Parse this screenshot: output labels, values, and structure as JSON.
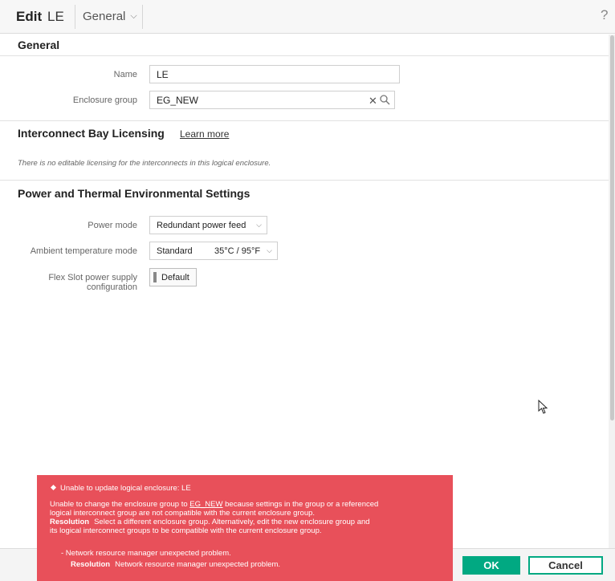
{
  "header": {
    "edit_label": "Edit",
    "resource_name": "LE",
    "section_selector": "General",
    "help": "?"
  },
  "general": {
    "title": "General",
    "name_label": "Name",
    "name_value": "LE",
    "enclosure_group_label": "Enclosure group",
    "enclosure_group_value": "EG_NEW",
    "clear_glyph": "✕"
  },
  "licensing": {
    "title": "Interconnect Bay Licensing",
    "learn_more": "Learn more",
    "info": "There is no editable licensing for the interconnects in this logical enclosure."
  },
  "power": {
    "title": "Power and Thermal Environmental Settings",
    "power_mode_label": "Power mode",
    "power_mode_value": "Redundant power feed",
    "ambient_label": "Ambient temperature mode",
    "ambient_value": "Standard",
    "ambient_suffix": "35°C / 95°F",
    "flex_label_line1": "Flex Slot power supply",
    "flex_label_line2": "configuration",
    "flex_button": "Default"
  },
  "error": {
    "title": "Unable to update logical enclosure: LE",
    "msg_pre": "Unable to change the enclosure group to",
    "msg_link": "EG_NEW",
    "msg_post": "because settings in the group or a referenced",
    "msg_line2": "logical interconnect group are not compatible with the current enclosure group.",
    "resolution_label": "Resolution",
    "resolution_line1": "Select a different enclosure group. Alternatively, edit the new enclosure group and",
    "resolution_line2": "its logical interconnect groups to be compatible with the current enclosure group.",
    "sub_item": "-  Network resource manager unexpected problem.",
    "sub_resolution_label": "Resolution",
    "sub_resolution": "Network resource manager unexpected problem."
  },
  "footer": {
    "ok": "OK",
    "cancel": "Cancel"
  },
  "colors": {
    "accent": "#01a982",
    "error": "#e8505a"
  }
}
